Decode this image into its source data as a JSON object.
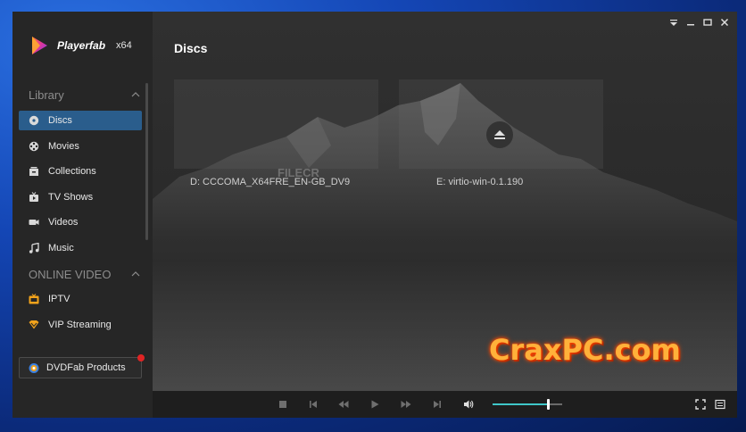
{
  "app": {
    "name": "Playerfab",
    "arch": "x64",
    "brand_colors": {
      "accent": "#2a5d8c",
      "volume": "#3fc7c9",
      "badge": "#e02424"
    }
  },
  "sidebar": {
    "library_header": "Library",
    "library_items": [
      {
        "label": "Discs",
        "icon": "disc-icon",
        "active": true
      },
      {
        "label": "Movies",
        "icon": "film-reel-icon"
      },
      {
        "label": "Collections",
        "icon": "collections-icon"
      },
      {
        "label": "TV Shows",
        "icon": "tv-icon"
      },
      {
        "label": "Videos",
        "icon": "video-camera-icon"
      },
      {
        "label": "Music",
        "icon": "music-note-icon"
      }
    ],
    "online_header": "ONLINE VIDEO",
    "online_items": [
      {
        "label": "IPTV",
        "icon": "iptv-icon"
      },
      {
        "label": "VIP Streaming",
        "icon": "vip-icon"
      }
    ],
    "products_label": "DVDFab Products"
  },
  "main": {
    "title": "Discs",
    "discs": [
      {
        "label": "D: CCCOMA_X64FRE_EN-GB_DV9"
      },
      {
        "label": "E: virtio-win-0.1.190",
        "eject": true
      }
    ],
    "watermarks": [
      "FILECR",
      "CraxPC.com"
    ]
  },
  "player": {
    "volume_percent": 80
  }
}
